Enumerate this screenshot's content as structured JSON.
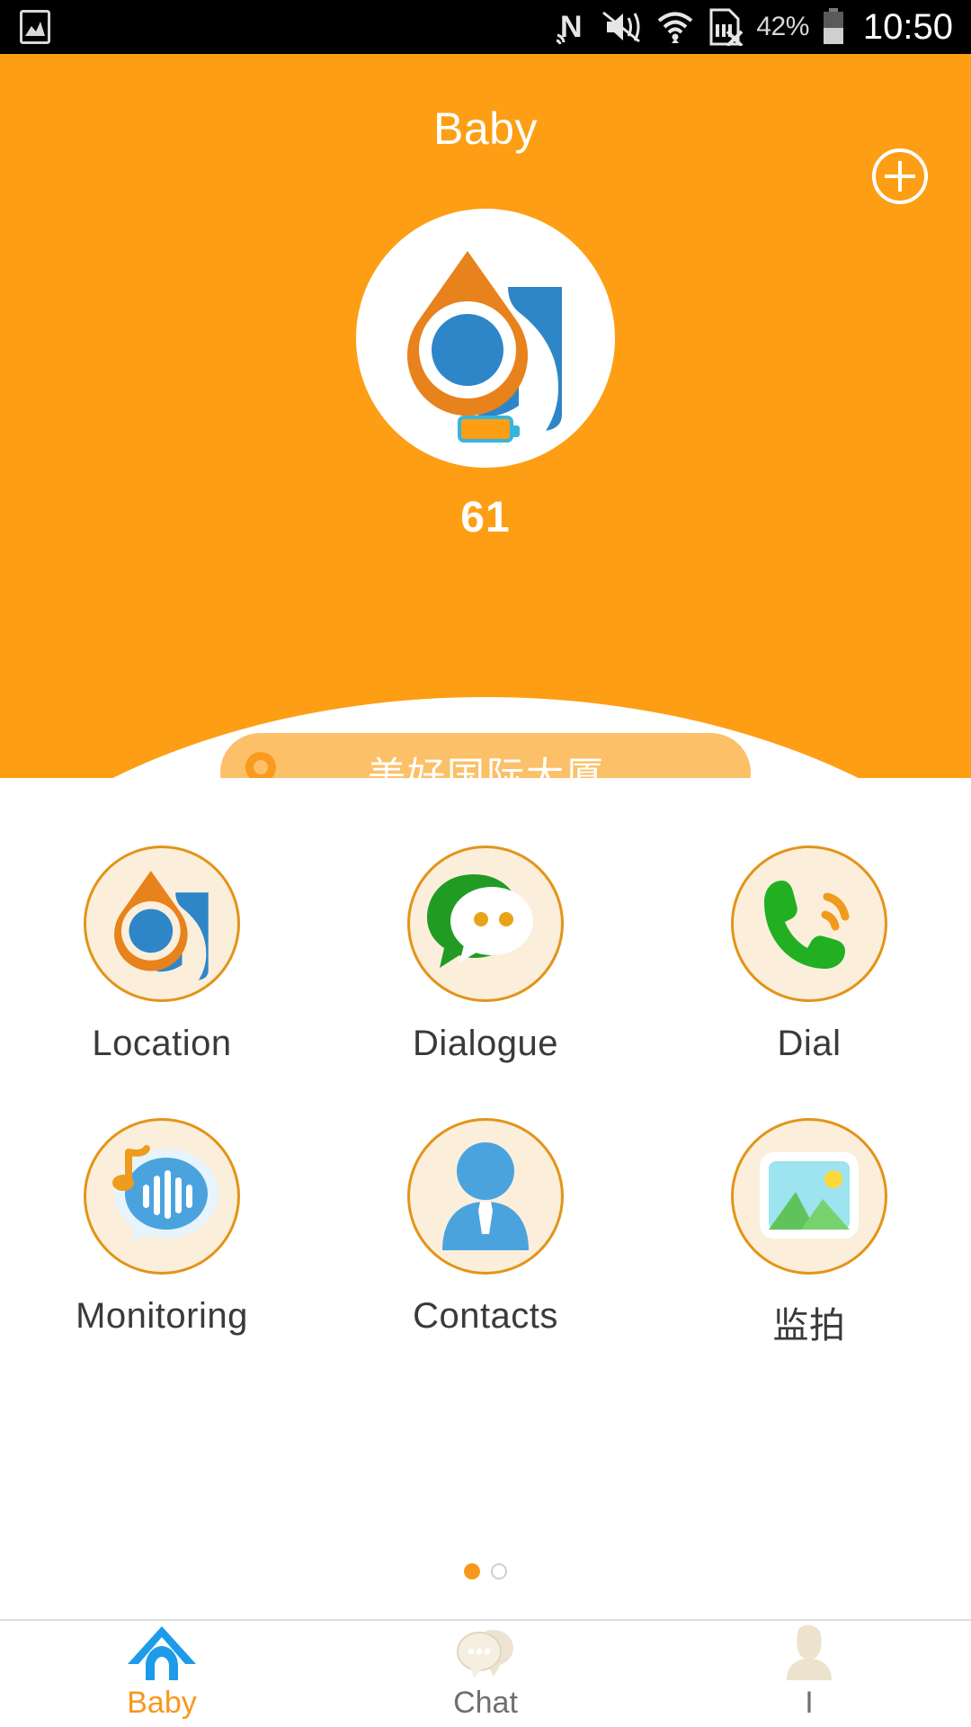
{
  "status_bar": {
    "left_icons": [
      "image-icon"
    ],
    "right_icons": [
      "nfc-icon",
      "sound-mute-icon",
      "wifi-icon",
      "sim-card-error-icon"
    ],
    "battery_percent": "42%",
    "clock": "10:50"
  },
  "header": {
    "title": "Baby",
    "add_button_label": "+",
    "background_color": "#FD9E14",
    "device": {
      "battery_value": "61",
      "avatar_icon": "app-logo-droplet"
    },
    "location": {
      "icon": "map-pin-icon",
      "text": "美好国际大厦",
      "pill_color": "#FBC068"
    }
  },
  "grid": {
    "items": [
      {
        "label": "Location",
        "icon": "droplet-logo-icon"
      },
      {
        "label": "Dialogue",
        "icon": "speech-bubble-green-icon"
      },
      {
        "label": "Dial",
        "icon": "phone-handset-icon"
      },
      {
        "label": "Monitoring",
        "icon": "voice-wave-bubble-icon"
      },
      {
        "label": "Contacts",
        "icon": "person-contact-icon"
      },
      {
        "label": "监拍",
        "icon": "photo-picture-icon"
      }
    ],
    "pagination": {
      "total": 2,
      "active_index": 0,
      "active_color": "#F7981D"
    }
  },
  "bottom_nav": {
    "items": [
      {
        "label": "Baby",
        "icon": "home-icon",
        "active": true
      },
      {
        "label": "Chat",
        "icon": "chat-bubbles-icon",
        "active": false
      },
      {
        "label": "I",
        "icon": "person-profile-icon",
        "active": false
      }
    ]
  }
}
